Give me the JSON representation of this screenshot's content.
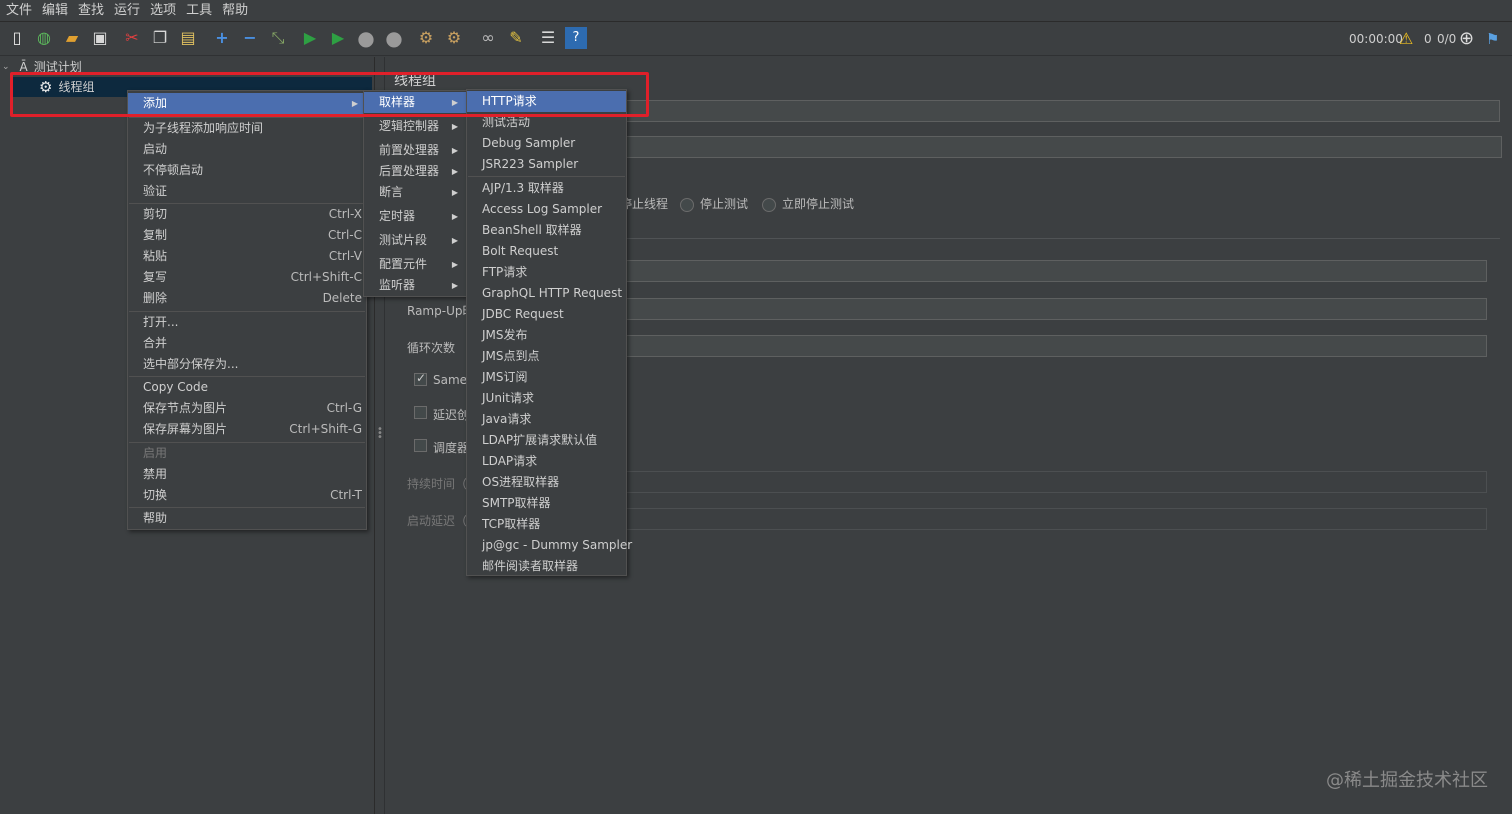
{
  "menubar": [
    "文件",
    "编辑",
    "查找",
    "运行",
    "选项",
    "工具",
    "帮助"
  ],
  "toolbar": {
    "timer": "00:00:00",
    "warning_count": "0",
    "threads": "0/0",
    "icons": [
      "new-icon",
      "templates-icon",
      "open-icon",
      "save-icon",
      "cut-icon",
      "copy-icon",
      "paste-icon",
      "expand-icon",
      "collapse-icon",
      "toggle-icon",
      "start-icon",
      "start-no-pause-icon",
      "stop-icon",
      "shutdown-icon",
      "clear-icon",
      "clear-all-icon",
      "search-icon",
      "reset-search-icon",
      "function-helper-icon",
      "help-icon"
    ]
  },
  "tree": {
    "root": "测试计划",
    "child": "线程组"
  },
  "panel": {
    "title": "线程组",
    "radio_options": [
      "停止线程",
      "停止测试",
      "立即停止测试"
    ],
    "ramp_label": "Ramp-Up时",
    "loop_label": "循环次数",
    "same_label": "Same",
    "delay_label": "延迟创",
    "scheduler_label": "调度器",
    "duration_label": "持续时间（",
    "startup_delay_label": "启动延迟（"
  },
  "context_menu": {
    "items": [
      {
        "label": "添加",
        "submenu": true,
        "active": true
      },
      {
        "label": "为子线程添加响应时间"
      },
      {
        "label": "启动"
      },
      {
        "label": "不停顿启动"
      },
      {
        "label": "验证"
      },
      {
        "label": "剪切",
        "shortcut": "Ctrl-X"
      },
      {
        "label": "复制",
        "shortcut": "Ctrl-C"
      },
      {
        "label": "粘贴",
        "shortcut": "Ctrl-V"
      },
      {
        "label": "复写",
        "shortcut": "Ctrl+Shift-C"
      },
      {
        "label": "删除",
        "shortcut": "Delete"
      },
      {
        "label": "打开..."
      },
      {
        "label": "合并"
      },
      {
        "label": "选中部分保存为..."
      },
      {
        "label": "Copy Code"
      },
      {
        "label": "保存节点为图片",
        "shortcut": "Ctrl-G"
      },
      {
        "label": "保存屏幕为图片",
        "shortcut": "Ctrl+Shift-G"
      },
      {
        "label": "启用",
        "disabled": true
      },
      {
        "label": "禁用"
      },
      {
        "label": "切换",
        "shortcut": "Ctrl-T"
      },
      {
        "label": "帮助"
      }
    ]
  },
  "add_submenu": {
    "items": [
      "取样器",
      "逻辑控制器",
      "前置处理器",
      "后置处理器",
      "断言",
      "定时器",
      "测试片段",
      "配置元件",
      "监听器"
    ]
  },
  "sampler_submenu": {
    "items": [
      "HTTP请求",
      "测试活动",
      "Debug Sampler",
      "JSR223 Sampler",
      "AJP/1.3 取样器",
      "Access Log Sampler",
      "BeanShell 取样器",
      "Bolt Request",
      "FTP请求",
      "GraphQL HTTP Request",
      "JDBC Request",
      "JMS发布",
      "JMS点到点",
      "JMS订阅",
      "JUnit请求",
      "Java请求",
      "LDAP扩展请求默认值",
      "LDAP请求",
      "OS进程取样器",
      "SMTP取样器",
      "TCP取样器",
      "jp@gc - Dummy Sampler",
      "邮件阅读者取样器"
    ]
  },
  "watermark": "@稀土掘金技术社区",
  "colors": {
    "background": "#3c3f41",
    "menu_active": "#4b6eaf",
    "highlight_border": "#e0202a"
  }
}
